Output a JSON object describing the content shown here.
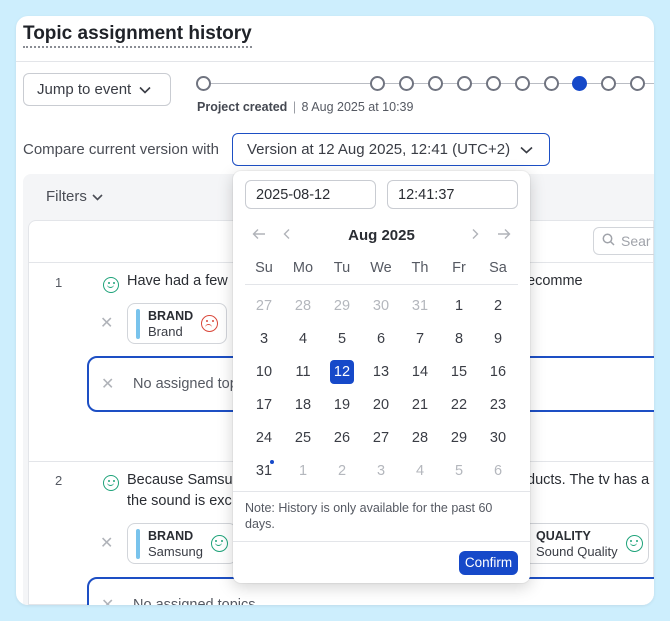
{
  "header": {
    "title": "Topic assignment history"
  },
  "toolbar": {
    "jump_label": "Jump to event",
    "timeline_label_bold": "Project created",
    "timeline_label_sep": "|",
    "timeline_label_date": "8 Aug 2025 at 10:39",
    "compare_label": "Compare current version with",
    "version_value": "Version at 12 Aug 2025, 12:41 (UTC+2)"
  },
  "filters": {
    "label": "Filters",
    "search_placeholder": "Sear"
  },
  "rows": [
    {
      "number": "1",
      "text": "Have had a few",
      "text_right": "ecomme",
      "chips": [
        {
          "key": "BRAND",
          "value": "Brand",
          "sentiment": "negative"
        }
      ],
      "assigned_label": "No assigned top"
    },
    {
      "number": "2",
      "text_line1": "Because Samsu",
      "text_line1_right": "ducts. The tv has a",
      "text_line2": "the sound is exc",
      "chips": [
        {
          "key": "BRAND",
          "value": "Samsung",
          "sentiment": "positive"
        },
        {
          "key": "QUALITY",
          "value": "Sound Quality",
          "sentiment": "positive"
        }
      ],
      "assigned_label": "No assigned topics"
    }
  ],
  "date_picker": {
    "date_value": "2025-08-12",
    "time_value": "12:41:37",
    "month_label": "Aug 2025",
    "weekdays": [
      "Su",
      "Mo",
      "Tu",
      "We",
      "Th",
      "Fr",
      "Sa"
    ],
    "weeks": [
      [
        "27",
        "28",
        "29",
        "30",
        "31",
        "1",
        "2"
      ],
      [
        "3",
        "4",
        "5",
        "6",
        "7",
        "8",
        "9"
      ],
      [
        "10",
        "11",
        "12",
        "13",
        "14",
        "15",
        "16"
      ],
      [
        "17",
        "18",
        "19",
        "20",
        "21",
        "22",
        "23"
      ],
      [
        "24",
        "25",
        "26",
        "27",
        "28",
        "29",
        "30"
      ],
      [
        "31",
        "1",
        "2",
        "3",
        "4",
        "5",
        "6"
      ]
    ],
    "selected": "12",
    "note": "Note: History is only available for the past 60 days.",
    "confirm_label": "Confirm"
  },
  "colors": {
    "accent": "#1649c9",
    "positive": "#1fa37a",
    "negative": "#d9483b",
    "chip_bar": "#79c3ec"
  }
}
